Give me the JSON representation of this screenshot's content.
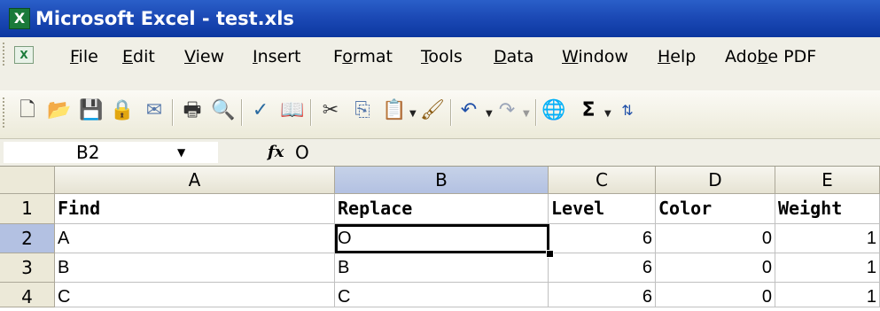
{
  "window": {
    "title": "Microsoft Excel - test.xls",
    "app_icon": "excel-icon"
  },
  "menu": {
    "items": [
      {
        "pre": "",
        "u": "F",
        "post": "ile"
      },
      {
        "pre": "",
        "u": "E",
        "post": "dit"
      },
      {
        "pre": "",
        "u": "V",
        "post": "iew"
      },
      {
        "pre": "",
        "u": "I",
        "post": "nsert"
      },
      {
        "pre": "F",
        "u": "o",
        "post": "rmat"
      },
      {
        "pre": "",
        "u": "T",
        "post": "ools"
      },
      {
        "pre": "",
        "u": "D",
        "post": "ata"
      },
      {
        "pre": "",
        "u": "W",
        "post": "indow"
      },
      {
        "pre": "",
        "u": "H",
        "post": "elp"
      },
      {
        "pre": "Ado",
        "u": "b",
        "post": "e PDF"
      }
    ]
  },
  "toolbar": {
    "icons": [
      "new-icon",
      "open-icon",
      "save-icon",
      "permission-icon",
      "print-icon",
      "print-preview-icon",
      "spelling-icon",
      "research-icon",
      "cut-icon",
      "copy-icon",
      "paste-icon",
      "format-painter-icon",
      "undo-icon",
      "redo-icon",
      "hyperlink-icon",
      "autosum-icon",
      "sort-ascending-icon"
    ],
    "autosum_glyph": "Σ"
  },
  "formula_bar": {
    "name_box": "B2",
    "fx_label": "fx",
    "value": "O"
  },
  "sheet": {
    "columns": [
      "A",
      "B",
      "C",
      "D",
      "E"
    ],
    "selected_column": "B",
    "rows": [
      {
        "num": "1",
        "cells": [
          "Find",
          "Replace",
          "Level",
          "Color",
          "Weight"
        ]
      },
      {
        "num": "2",
        "cells": [
          "A",
          "O",
          "6",
          "0",
          "1"
        ]
      },
      {
        "num": "3",
        "cells": [
          "B",
          "B",
          "6",
          "0",
          "1"
        ]
      },
      {
        "num": "4",
        "cells": [
          "C",
          "C",
          "6",
          "0",
          "1"
        ]
      }
    ],
    "active_cell": "B2",
    "selected_row": "2"
  }
}
